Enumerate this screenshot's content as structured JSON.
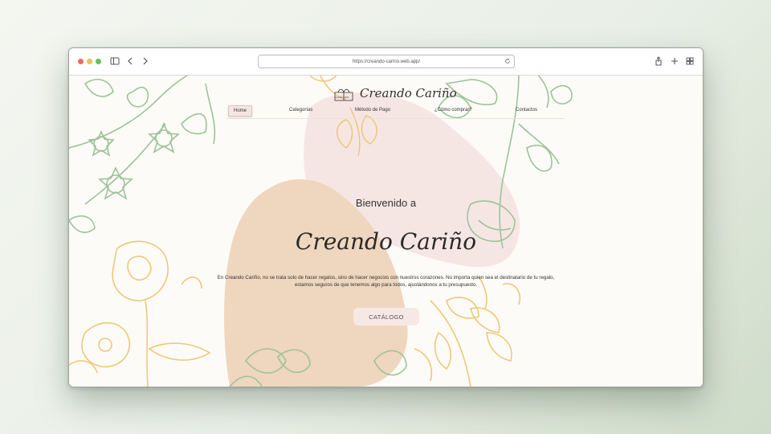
{
  "browser": {
    "url": "https://creando-carino.web.app/",
    "icons": [
      "sidebar-icon",
      "back-icon",
      "forward-icon",
      "reload-icon",
      "share-icon",
      "new-tab-icon",
      "tab-overview-icon"
    ]
  },
  "site": {
    "brand": "Creando Cariño",
    "logo_caption": "Creando Cariño"
  },
  "nav": {
    "items": [
      {
        "label": "Home",
        "active": true
      },
      {
        "label": "Categorías",
        "active": false
      },
      {
        "label": "Método de Pago",
        "active": false
      },
      {
        "label": "¿Cómo comprar?",
        "active": false
      },
      {
        "label": "Contactos",
        "active": false
      }
    ]
  },
  "hero": {
    "welcome": "Bienvenido a",
    "title": "Creando Cariño",
    "description": "En Creando Cariño, no se trata solo de hacer regalos, sino de hacer negocios con nuestros corazones. No importa quien sea el destinatario de tu regalo, estamos seguros de que tenemos algo para todos, ajustándonos a tu presupuesto.",
    "button": "CATÁLOGO"
  },
  "colors": {
    "background": "#fdfbf7",
    "pink_blob": "#f6e6e3",
    "tan_blob": "#efd6be",
    "green_line": "#9cc39a",
    "yellow_line": "#ecc97a",
    "button_bg": "#f6e8e5"
  }
}
